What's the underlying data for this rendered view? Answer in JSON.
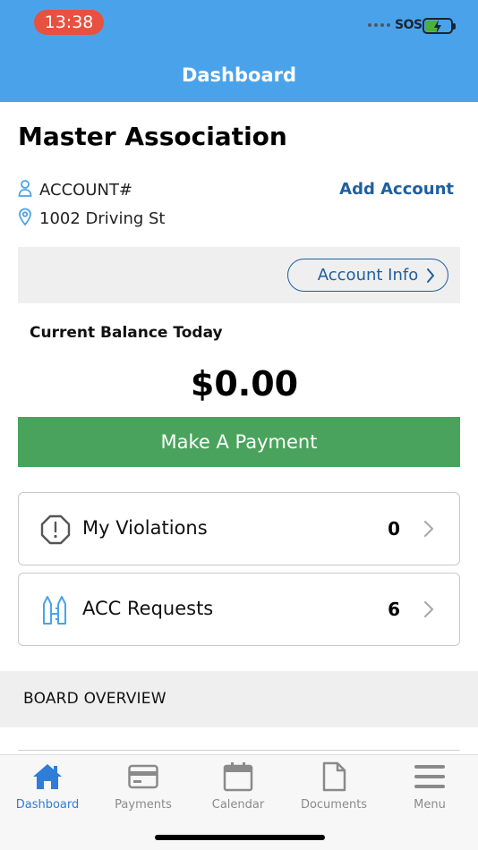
{
  "status_bar": {
    "time": "13:38",
    "carrier": "SOS",
    "accent_time_pill": "#e8503f"
  },
  "header": {
    "title": "Dashboard",
    "background": "#4aa3ea"
  },
  "account": {
    "association_name": "Master Association",
    "account_label": "ACCOUNT#",
    "address": "1002 Driving St",
    "add_account_label": "Add Account",
    "account_info_label": "Account Info"
  },
  "balance": {
    "label": "Current Balance Today",
    "amount": "$0.00",
    "pay_button_label": "Make A Payment",
    "pay_button_color": "#4aa35c"
  },
  "cards": [
    {
      "label": "My Violations",
      "count": "0",
      "icon": "alert-octagon-icon"
    },
    {
      "label": "ACC Requests",
      "count": "6",
      "icon": "architecture-icon"
    }
  ],
  "board": {
    "section_title": "BOARD OVERVIEW"
  },
  "tabs": [
    {
      "label": "Dashboard",
      "icon": "home-icon",
      "active": true
    },
    {
      "label": "Payments",
      "icon": "credit-card-icon",
      "active": false
    },
    {
      "label": "Calendar",
      "icon": "calendar-icon",
      "active": false
    },
    {
      "label": "Documents",
      "icon": "document-icon",
      "active": false
    },
    {
      "label": "Menu",
      "icon": "hamburger-menu-icon",
      "active": false
    }
  ]
}
